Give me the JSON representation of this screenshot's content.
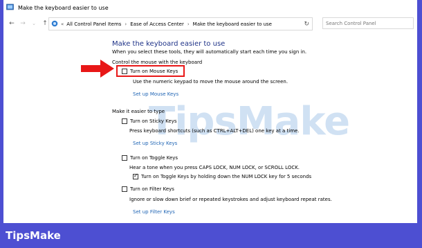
{
  "window": {
    "title": "Make the keyboard easier to use"
  },
  "nav": {
    "crumbs": [
      "All Control Panel Items",
      "Ease of Access Center",
      "Make the keyboard easier to use"
    ],
    "search_placeholder": "Search Control Panel"
  },
  "page": {
    "title": "Make the keyboard easier to use",
    "subtitle": "When you select these tools, they will automatically start each time you sign in."
  },
  "section_mouse": {
    "heading": "Control the mouse with the keyboard",
    "checkbox": "Turn on Mouse Keys",
    "checked": false,
    "description": "Use the numeric keypad to move the mouse around the screen.",
    "link": "Set up Mouse Keys"
  },
  "section_type": {
    "heading": "Make it easier to type",
    "sticky": {
      "checkbox": "Turn on Sticky Keys",
      "checked": false,
      "description": "Press keyboard shortcuts (such as CTRL+ALT+DEL) one key at a time.",
      "link": "Set up Sticky Keys"
    },
    "toggle": {
      "checkbox": "Turn on Toggle Keys",
      "checked": false,
      "description": "Hear a tone when you press CAPS LOCK, NUM LOCK, or SCROLL LOCK.",
      "sub_checkbox": "Turn on Toggle Keys by holding down the NUM LOCK key for 5 seconds",
      "sub_checked": true
    },
    "filter": {
      "checkbox": "Turn on Filter Keys",
      "checked": false,
      "description": "Ignore or slow down brief or repeated keystrokes and adjust keyboard repeat rates.",
      "link": "Set up Filter Keys"
    }
  },
  "watermark": "TipsMake",
  "footer": {
    "brand": "TipsMake"
  },
  "colors": {
    "border": "#4d4fd2",
    "highlight": "#e81717",
    "arrow": "#e81717",
    "link": "#1e64b4",
    "title": "#1e3287"
  }
}
